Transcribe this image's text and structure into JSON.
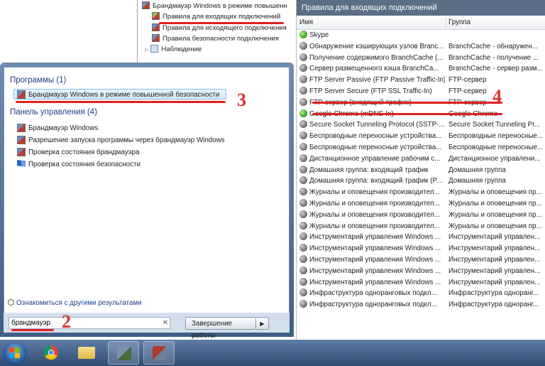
{
  "tree": {
    "root": "Брандмауэр Windows в режиме повышенн",
    "items": [
      "Правила для входящих подключений",
      "Правила для исходящего подключения",
      "Правила безопасности подключения",
      "Наблюдение"
    ]
  },
  "rules": {
    "title": "Правила для входящих подключений",
    "col_name": "Имя",
    "col_group": "Группа",
    "rows": [
      {
        "name": "Skype",
        "group": "",
        "enabled": true
      },
      {
        "name": "Обнаружение кэширующих узлов Branc...",
        "group": "BranchCache - обнаружен...",
        "enabled": false
      },
      {
        "name": "Получение содержимого BranchCache (...",
        "group": "BranchCache - получение ...",
        "enabled": false
      },
      {
        "name": "Сервер размещенного кэша BranchCa...",
        "group": "BranchCache - сервер разм...",
        "enabled": false
      },
      {
        "name": "FTP Server Passive (FTP Passive Traffic-In)",
        "group": "FTP-сервер",
        "enabled": false
      },
      {
        "name": "FTP Server Secure (FTP SSL Traffic-In)",
        "group": "FTP-сервер",
        "enabled": false
      },
      {
        "name": "FTP-сервер (входящий трафик)",
        "group": "FTP-сервер",
        "enabled": false
      },
      {
        "name": "Google Chrome (mDNS-In)",
        "group": "Google Chrome",
        "enabled": true
      },
      {
        "name": "Secure Socket Tunneling Protocol (SSTP-...",
        "group": "Secure Socket Tunneling Pr...",
        "enabled": false
      },
      {
        "name": "Беспроводные переносные устройства...",
        "group": "Беспроводные переносные...",
        "enabled": false
      },
      {
        "name": "Беспроводные переносные устройства...",
        "group": "Беспроводные переносные...",
        "enabled": false
      },
      {
        "name": "Дистанционное управление рабочим с...",
        "group": "Дистанционное управлени...",
        "enabled": false
      },
      {
        "name": "Домашняя группа: входящий трафик",
        "group": "Домашняя группа",
        "enabled": false
      },
      {
        "name": "Домашняя группа: входящий трафик (P...",
        "group": "Домашняя группа",
        "enabled": false
      },
      {
        "name": "Журналы и оповещения производител...",
        "group": "Журналы и оповещения пр...",
        "enabled": false
      },
      {
        "name": "Журналы и оповещения производител...",
        "group": "Журналы и оповещения пр...",
        "enabled": false
      },
      {
        "name": "Журналы и оповещения производител...",
        "group": "Журналы и оповещения пр...",
        "enabled": false
      },
      {
        "name": "Журналы и оповещения производител...",
        "group": "Журналы и оповещения пр...",
        "enabled": false
      },
      {
        "name": "Инструментарий управления Windows ...",
        "group": "Инструментарий управлен...",
        "enabled": false
      },
      {
        "name": "Инструментарий управления Windows ...",
        "group": "Инструментарий управлен...",
        "enabled": false
      },
      {
        "name": "Инструментарий управления Windows ...",
        "group": "Инструментарий управлен...",
        "enabled": false
      },
      {
        "name": "Инструментарий управления Windows ...",
        "group": "Инструментарий управлен...",
        "enabled": false
      },
      {
        "name": "Инструментарий управления Windows ...",
        "group": "Инструментарий управлен...",
        "enabled": false
      },
      {
        "name": "Инфраструктура одноранговых подкл...",
        "group": "Инфраструктура одноранг...",
        "enabled": false
      },
      {
        "name": "Инфраструктура одноранговых подкл...",
        "group": "Инфраструктура одноранг...",
        "enabled": false
      }
    ]
  },
  "startmenu": {
    "programs_header": "Программы (1)",
    "program_item": "Брандмауэр Windows в режиме повышенной безопасности",
    "control_header": "Панель управления (4)",
    "control_items": [
      "Брандмауэр Windows",
      "Разрешение запуска программы через брандмауэр Windows",
      "Проверка состояния брандмауэра",
      "Проверка состояния безопасности"
    ],
    "more_results": "Ознакомиться с другими результатами",
    "search_value": "брандмауэр",
    "shutdown_label": "Завершение работы"
  },
  "annotations": [
    "2",
    "3",
    "4"
  ],
  "colors": {
    "annotation": "#e02020",
    "title_bar": "#5c6e86",
    "link_blue": "#1a3f8c"
  }
}
